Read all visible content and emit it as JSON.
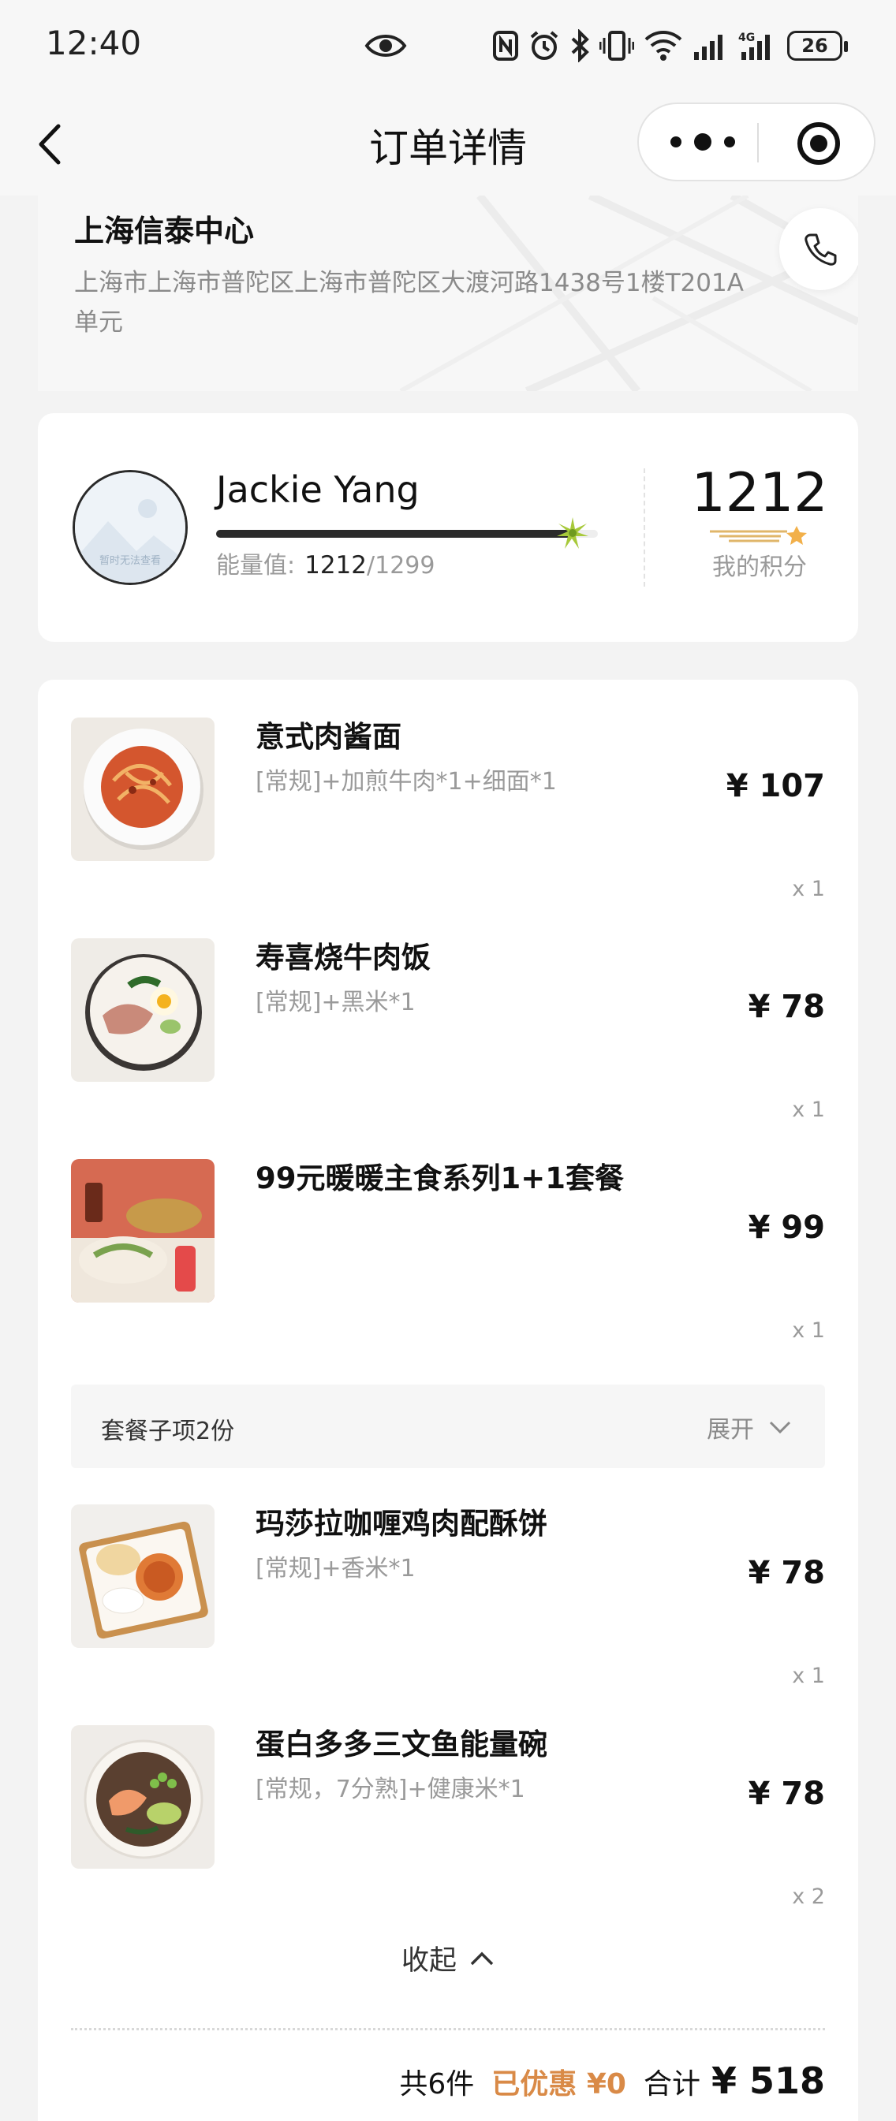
{
  "status_bar": {
    "time": "12:40",
    "battery": "26",
    "icons": [
      "eye-icon",
      "nfc-icon",
      "alarm-icon",
      "bluetooth-icon",
      "vibrate-icon",
      "wifi-icon",
      "signal-icon",
      "signal-4g-icon",
      "battery-icon"
    ]
  },
  "nav": {
    "title": "订单详情",
    "back_icon": "chevron-left-icon",
    "more_icon": "more-dots-icon",
    "target_icon": "record-target-icon"
  },
  "address": {
    "name": "上海信泰中心",
    "detail": "上海市上海市普陀区上海市普陀区大渡河路1438号1楼T201A单元",
    "phone_icon": "phone-icon"
  },
  "member": {
    "name": "Jackie Yang",
    "avatar_text": "暂时无法查看",
    "energy_label": "能量值:",
    "energy_current": "1212",
    "energy_max": "/1299",
    "energy_progress": 0.933,
    "points": "1212",
    "points_label": "我的积分"
  },
  "items": [
    {
      "name": "意式肉酱面",
      "spec": "[常规]+加煎牛肉*1+细面*1",
      "price": "¥ 107",
      "qty": "x 1"
    },
    {
      "name": "寿喜烧牛肉饭",
      "spec": "[常规]+黑米*1",
      "price": "¥ 78",
      "qty": "x 1"
    },
    {
      "name": "99元暖暖主食系列1+1套餐",
      "spec": "",
      "price": "¥ 99",
      "qty": "x 1"
    },
    {
      "name": "玛莎拉咖喱鸡肉配酥饼",
      "spec": "[常规]+香米*1",
      "price": "¥ 78",
      "qty": "x 1"
    },
    {
      "name": "蛋白多多三文鱼能量碗",
      "spec": "[常规，7分熟]+健康米*1",
      "price": "¥ 78",
      "qty": "x 2"
    }
  ],
  "combo": {
    "label": "套餐子项2份",
    "expand": "展开"
  },
  "collapse_label": "收起",
  "summary": {
    "count": "共6件",
    "discount": "已优惠 ¥0",
    "total_label": "合计",
    "total": "¥ 518"
  },
  "colors": {
    "accent_discount": "#d98a47",
    "text_primary": "#111111",
    "text_secondary": "#9a9a9a",
    "page_bg": "#f3f3f3"
  }
}
